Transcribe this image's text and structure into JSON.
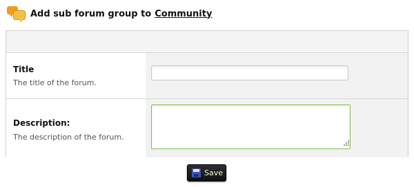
{
  "header": {
    "title_prefix": "Add sub forum group to",
    "forum_link": "Community",
    "icon": "chat-bubbles-icon"
  },
  "form": {
    "fields": [
      {
        "label": "Title",
        "description": "The title of the forum.",
        "value": "",
        "placeholder": ""
      },
      {
        "label": "Description:",
        "description": "The description of the forum.",
        "value": "",
        "placeholder": ""
      }
    ],
    "focus_color": "#7fbf4c"
  },
  "actions": {
    "save_label": "Save",
    "save_icon": "floppy-disk-icon"
  }
}
